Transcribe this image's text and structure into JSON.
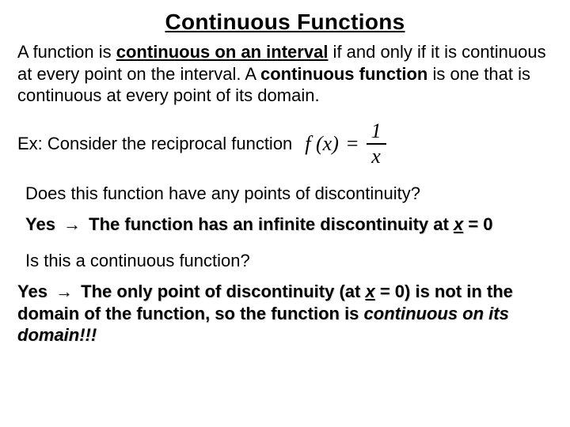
{
  "title": "Continuous Functions",
  "p1": {
    "a": "A function is ",
    "b": "continuous on an interval",
    "c": " if and only if it is continuous at every point on the interval.  A ",
    "d": "continuous function",
    "e": " is one that is continuous at every point of its domain."
  },
  "exLead": "Ex: Consider the reciprocal function",
  "formula": {
    "lhs": "f (x)",
    "eq": "=",
    "num": "1",
    "den": "x"
  },
  "q1": "Does this function have any points of discontinuity?",
  "ans1": {
    "yes": "Yes ",
    "arrow": "→",
    "a": " The function has an infinite discontinuity at ",
    "xvar": "x",
    "b": " = 0"
  },
  "q2": "Is this a continuous function?",
  "ans2": {
    "yes": "Yes ",
    "arrow": "→",
    "a": " The only point of discontinuity (at ",
    "xvar": "x",
    "b": " = 0) is not in the domain of the function, so the function is ",
    "c": "continuous on its domain!!!"
  }
}
